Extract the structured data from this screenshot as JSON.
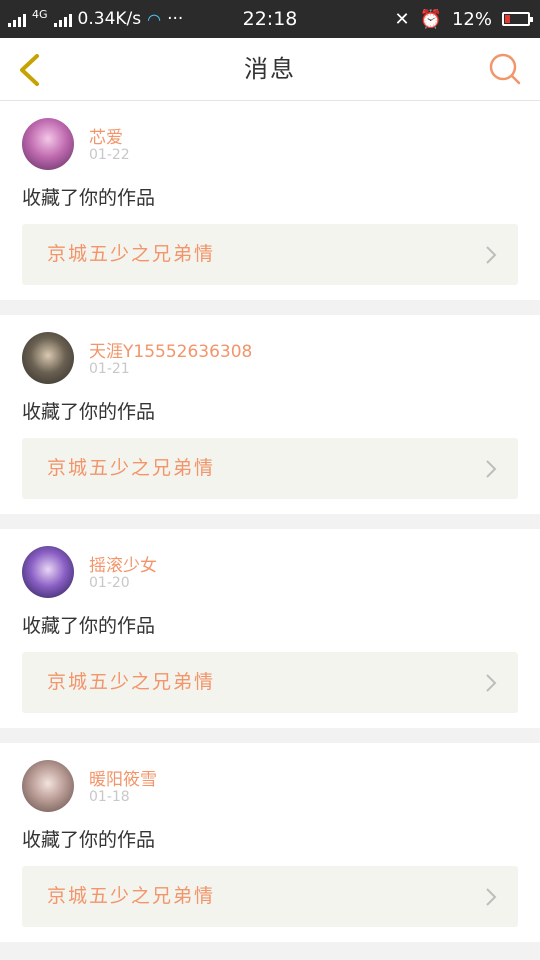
{
  "status_bar": {
    "network_speed": "0.34K/s",
    "net_type": "4G",
    "time": "22:18",
    "battery": "12%"
  },
  "header": {
    "title": "消息",
    "accent_color": "#f2956a"
  },
  "messages": [
    {
      "user": "芯爱",
      "date": "01-22",
      "action": "收藏了你的作品",
      "work": "京城五少之兄弟情"
    },
    {
      "user": "天涯Y15552636308",
      "date": "01-21",
      "action": "收藏了你的作品",
      "work": "京城五少之兄弟情"
    },
    {
      "user": "摇滚少女",
      "date": "01-20",
      "action": "收藏了你的作品",
      "work": "京城五少之兄弟情"
    },
    {
      "user": "暖阳筱雪",
      "date": "01-18",
      "action": "收藏了你的作品",
      "work": "京城五少之兄弟情"
    }
  ]
}
